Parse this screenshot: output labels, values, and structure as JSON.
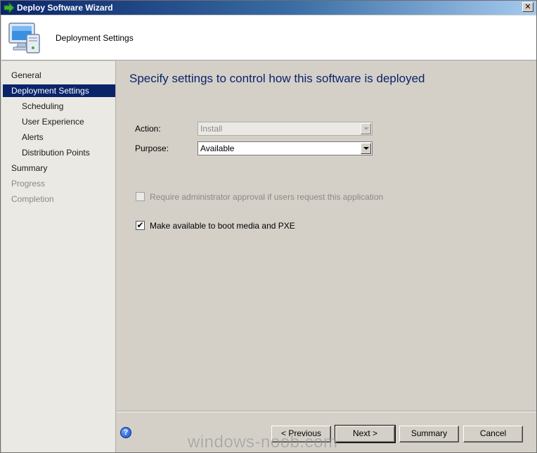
{
  "window": {
    "title": "Deploy Software Wizard",
    "close_glyph": "✕"
  },
  "header": {
    "title": "Deployment Settings",
    "icon": "computer-monitor-icon"
  },
  "nav": {
    "items": [
      {
        "label": "General",
        "state": "normal"
      },
      {
        "label": "Deployment Settings",
        "state": "selected"
      },
      {
        "label": "Scheduling",
        "state": "normal"
      },
      {
        "label": "User Experience",
        "state": "normal"
      },
      {
        "label": "Alerts",
        "state": "normal"
      },
      {
        "label": "Distribution Points",
        "state": "normal"
      },
      {
        "label": "Summary",
        "state": "normal"
      },
      {
        "label": "Progress",
        "state": "disabled"
      },
      {
        "label": "Completion",
        "state": "disabled"
      }
    ]
  },
  "main": {
    "heading": "Specify settings to control how this software is deployed",
    "action": {
      "label": "Action:",
      "value": "Install",
      "enabled": false
    },
    "purpose": {
      "label": "Purpose:",
      "value": "Available",
      "enabled": true
    },
    "require_approval": {
      "label": "Require administrator approval if users request this application",
      "checked": false,
      "enabled": false
    },
    "boot_media": {
      "label": "Make available to boot media and PXE",
      "checked": true,
      "enabled": true
    }
  },
  "buttons": {
    "help_glyph": "?",
    "previous": "< Previous",
    "next": "Next >",
    "summary": "Summary",
    "cancel": "Cancel"
  },
  "watermark": "windows-noob.com",
  "colors": {
    "selected_bg": "#0a246a",
    "heading": "#0a246a",
    "window_bg": "#d4d0c8"
  }
}
